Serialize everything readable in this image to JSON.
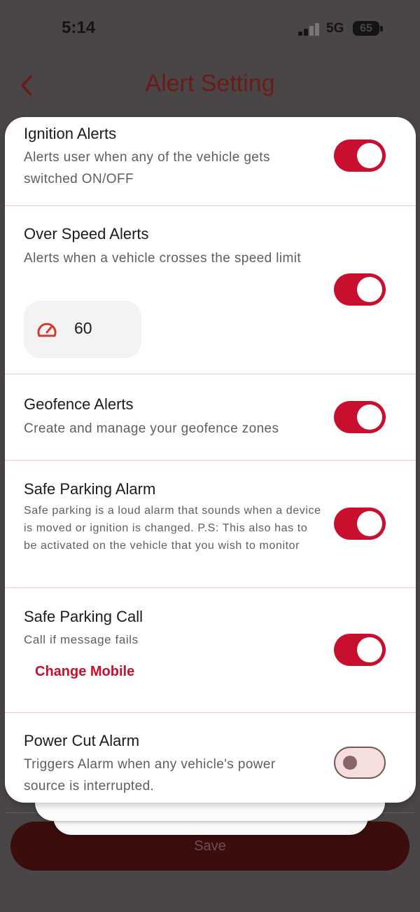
{
  "status_bar": {
    "time": "5:14",
    "network": "5G",
    "battery": "65"
  },
  "header": {
    "title": "Alert Setting"
  },
  "alerts": [
    {
      "title": "Ignition Alerts",
      "description": "Alerts user when any of the vehicle gets switched ON/OFF",
      "enabled": true
    },
    {
      "title": "Over Speed Alerts",
      "description": "Alerts when a vehicle crosses the speed limit",
      "speed_limit": "60",
      "enabled": true
    },
    {
      "title": "Geofence Alerts",
      "description": "Create and manage your geofence zones",
      "enabled": true
    },
    {
      "title": "Safe Parking Alarm",
      "description": "Safe parking is a loud alarm that sounds when a device is moved or ignition is changed. P.S: This also has to be activated on the vehicle that you wish to monitor",
      "enabled": true
    },
    {
      "title": "Safe Parking Call",
      "description": "Call  if message fails",
      "link": "Change Mobile",
      "enabled": true
    },
    {
      "title": "Power Cut Alarm",
      "description": "Triggers Alarm when any vehicle's power source is interrupted.",
      "enabled": false
    }
  ],
  "footer": {
    "save_label": "Save"
  },
  "colors": {
    "accent": "#c8102e",
    "title": "#6b1a1a"
  }
}
